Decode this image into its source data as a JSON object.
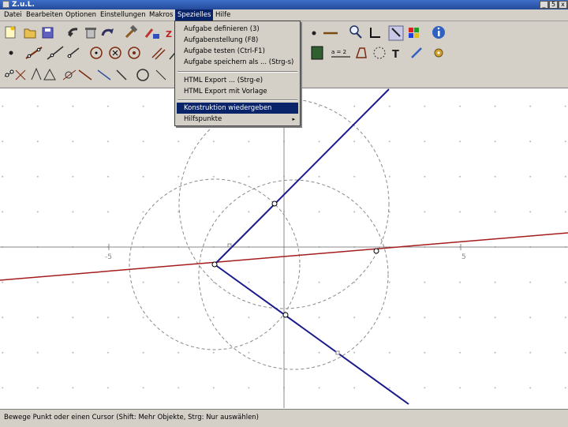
{
  "window": {
    "title": "Z.u.L.",
    "buttons": [
      "_",
      "5",
      "x"
    ]
  },
  "menu": {
    "items": [
      "Datei",
      "Bearbeiten",
      "Optionen",
      "Einstellungen",
      "Makros",
      "Spezielles",
      "Hilfe"
    ],
    "open_index": 5
  },
  "dropdown": {
    "items": [
      "Aufgabe definieren (3)",
      "Aufgabenstellung (F8)",
      "Aufgabe testen (Ctrl-F1)",
      "Aufgabe speichern als ... (Strg-s)",
      "HTML Export ... (Strg-e)",
      "HTML Export mit Vorlage",
      "Konstruktion wiedergeben",
      "Hilfspunkte"
    ],
    "selected_index": 6,
    "submenu_index": 7,
    "submenu_arrow": "▸"
  },
  "toolbar": {
    "letters": {
      "z": "Z",
      "t": "T",
      "eq": "a = 2"
    }
  },
  "canvas": {
    "x_labels": [
      "-5",
      "5"
    ],
    "colors": {
      "grid_dot": "#b8b8b8",
      "axis": "#888888",
      "circle": "#8a8a8a",
      "line_dark": "#1a1a8c",
      "line_red": "#a51c1c"
    }
  },
  "status": {
    "text": "Bewege Punkt oder einen Cursor (Shift: Mehr Objekte, Strg: Nur auswählen)"
  }
}
